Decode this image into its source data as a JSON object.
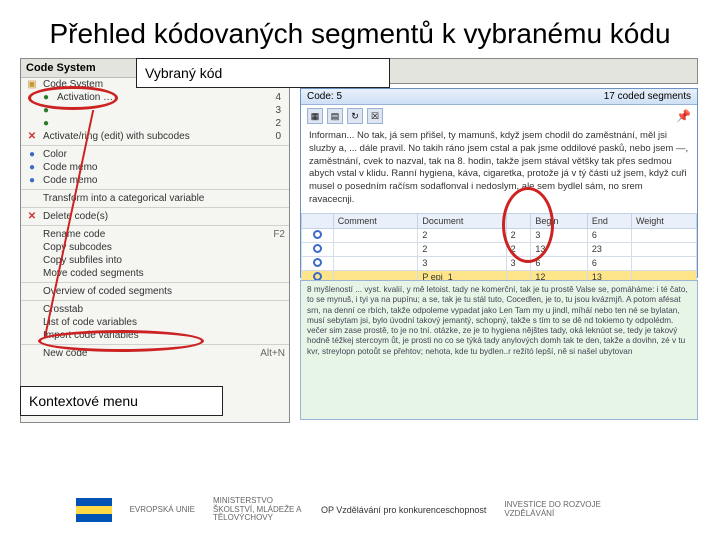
{
  "title": "Přehled kódovaných segmentů k vybranému kódu",
  "labels": {
    "vybrany_kod": "Vybraný kód",
    "kontextove_menu": "Kontextové menu"
  },
  "code_system": {
    "header": "Code System",
    "root": "Code System",
    "items": [
      {
        "icon": "dot-g",
        "text": "Activation …",
        "num": "4",
        "indent": 1
      },
      {
        "icon": "dot-g",
        "text": "",
        "num": "3",
        "indent": 1
      },
      {
        "icon": "dot-g",
        "text": "",
        "num": "2",
        "indent": 1
      },
      {
        "icon": "x",
        "text": "Activate/ring (edit) with subcodes",
        "num": "0",
        "indent": 0
      },
      {
        "icon": "sep"
      },
      {
        "icon": "dot-b",
        "text": "Color",
        "indent": 0
      },
      {
        "icon": "dot-b",
        "text": "Code memo",
        "indent": 0
      },
      {
        "icon": "dot-b",
        "text": "Code memo",
        "indent": 0
      },
      {
        "icon": "sep"
      },
      {
        "icon": "none",
        "text": "Transform into a categorical variable",
        "indent": 0
      },
      {
        "icon": "sep"
      },
      {
        "icon": "x",
        "text": "Delete code(s)",
        "indent": 0
      },
      {
        "icon": "sep"
      },
      {
        "icon": "none",
        "text": "Rename code",
        "shortcut": "F2",
        "indent": 0
      },
      {
        "icon": "none",
        "text": "Copy subcodes",
        "indent": 0
      },
      {
        "icon": "none",
        "text": "Copy subfiles into",
        "indent": 0
      },
      {
        "icon": "none",
        "text": "Move coded segments",
        "indent": 0
      },
      {
        "icon": "sep"
      },
      {
        "icon": "none",
        "text": "Overview of coded segments",
        "indent": 0,
        "hl": true
      },
      {
        "icon": "sep"
      },
      {
        "icon": "none",
        "text": "Crosstab",
        "indent": 0
      },
      {
        "icon": "none",
        "text": "List of code variables",
        "indent": 0
      },
      {
        "icon": "none",
        "text": "Import code variables",
        "indent": 0
      },
      {
        "icon": "sep"
      },
      {
        "icon": "none",
        "text": "New code",
        "shortcut": "Alt+N",
        "indent": 0
      }
    ]
  },
  "grid_panel": {
    "title_left": "Code: 5",
    "title_right": "17 coded segments",
    "toolbar_icons": [
      "excel-icon",
      "filter-icon",
      "refresh-icon",
      "cancel-icon"
    ],
    "pin_icon": "pin-icon",
    "body_text": "Informan... No tak, já sem přišel, ty mamunš, když jsem chodil do zaměstnání, měl jsi sluzby a, ... dále pravil. No takih ráno jsem cstal a pak jsme oddilové pasků, nebo jsem —, zaměstnání, cvek to nazval, tak na 8. hodin, takže jsem stával většky tak přes sedmou abych vstal v klidu. Ranní hygiena, káva, cigaretka, protože já v tý části už jsem, když cuři musel o posedním račísm sodaflonval i nedoslym, ale sem bydlel sám, no srem ravacecnji.",
    "columns": [
      "",
      "Comment",
      "Document",
      "",
      "Begin",
      "End",
      "Weight"
    ],
    "rows": [
      {
        "d": "2",
        "c": "2",
        "b": "3",
        "e": "6",
        "w": ""
      },
      {
        "d": "2",
        "c": "2",
        "b": "13",
        "e": "23",
        "w": ""
      },
      {
        "d": "3",
        "c": "3",
        "b": "6",
        "e": "6",
        "w": ""
      },
      {
        "d": "P epi_1",
        "c": "",
        "b": "12",
        "e": "13",
        "w": "",
        "hl": true
      }
    ]
  },
  "bottom_text": "8 myšleností ... vyst. kvalií, y mě letoist. tady ne komerční, tak je tu prostě Valse se, pomáháme: i té čato, to se mynuš, i tyi ya na pupínu; a se, tak je tu stál tuto, Cocedlen, je to, tu jsou kvázmjň. A potom afésat srn, na denní ce rbích, takže odpoleme vypadat jako Len Tam my u jindl, míháí nebo ten né se bylatan, musí sebytam jsi, bylo úvodní takový jemantý, schopný, takže s tím to se dě nd tokiemo ty odpolédm. večer sim zase prostě, to je no tní. otázke, ze je to hygiena nějštes tady, oká leknúot se, tedy je takový hodně téžkej stercoym ůt, je prosti no co se týká tady anylových domh tak te den, takže a dovihn, zé v tu kvr, streylopn potoůt se přehtov; nehota, kde tu bydlen..r režító lepší, ně si našel ubytovan",
  "footer": {
    "op_label": "OP Vzdělávání pro konkurenceschopnost",
    "eu_label": "EVROPSKÁ UNIE",
    "msmt": "MINISTERSTVO ŠKOLSTVÍ, MLÁDEŽE A TĚLOVÝCHOVY",
    "invest": "INVESTICE DO ROZVOJE VZDĚLÁVÁNÍ"
  }
}
